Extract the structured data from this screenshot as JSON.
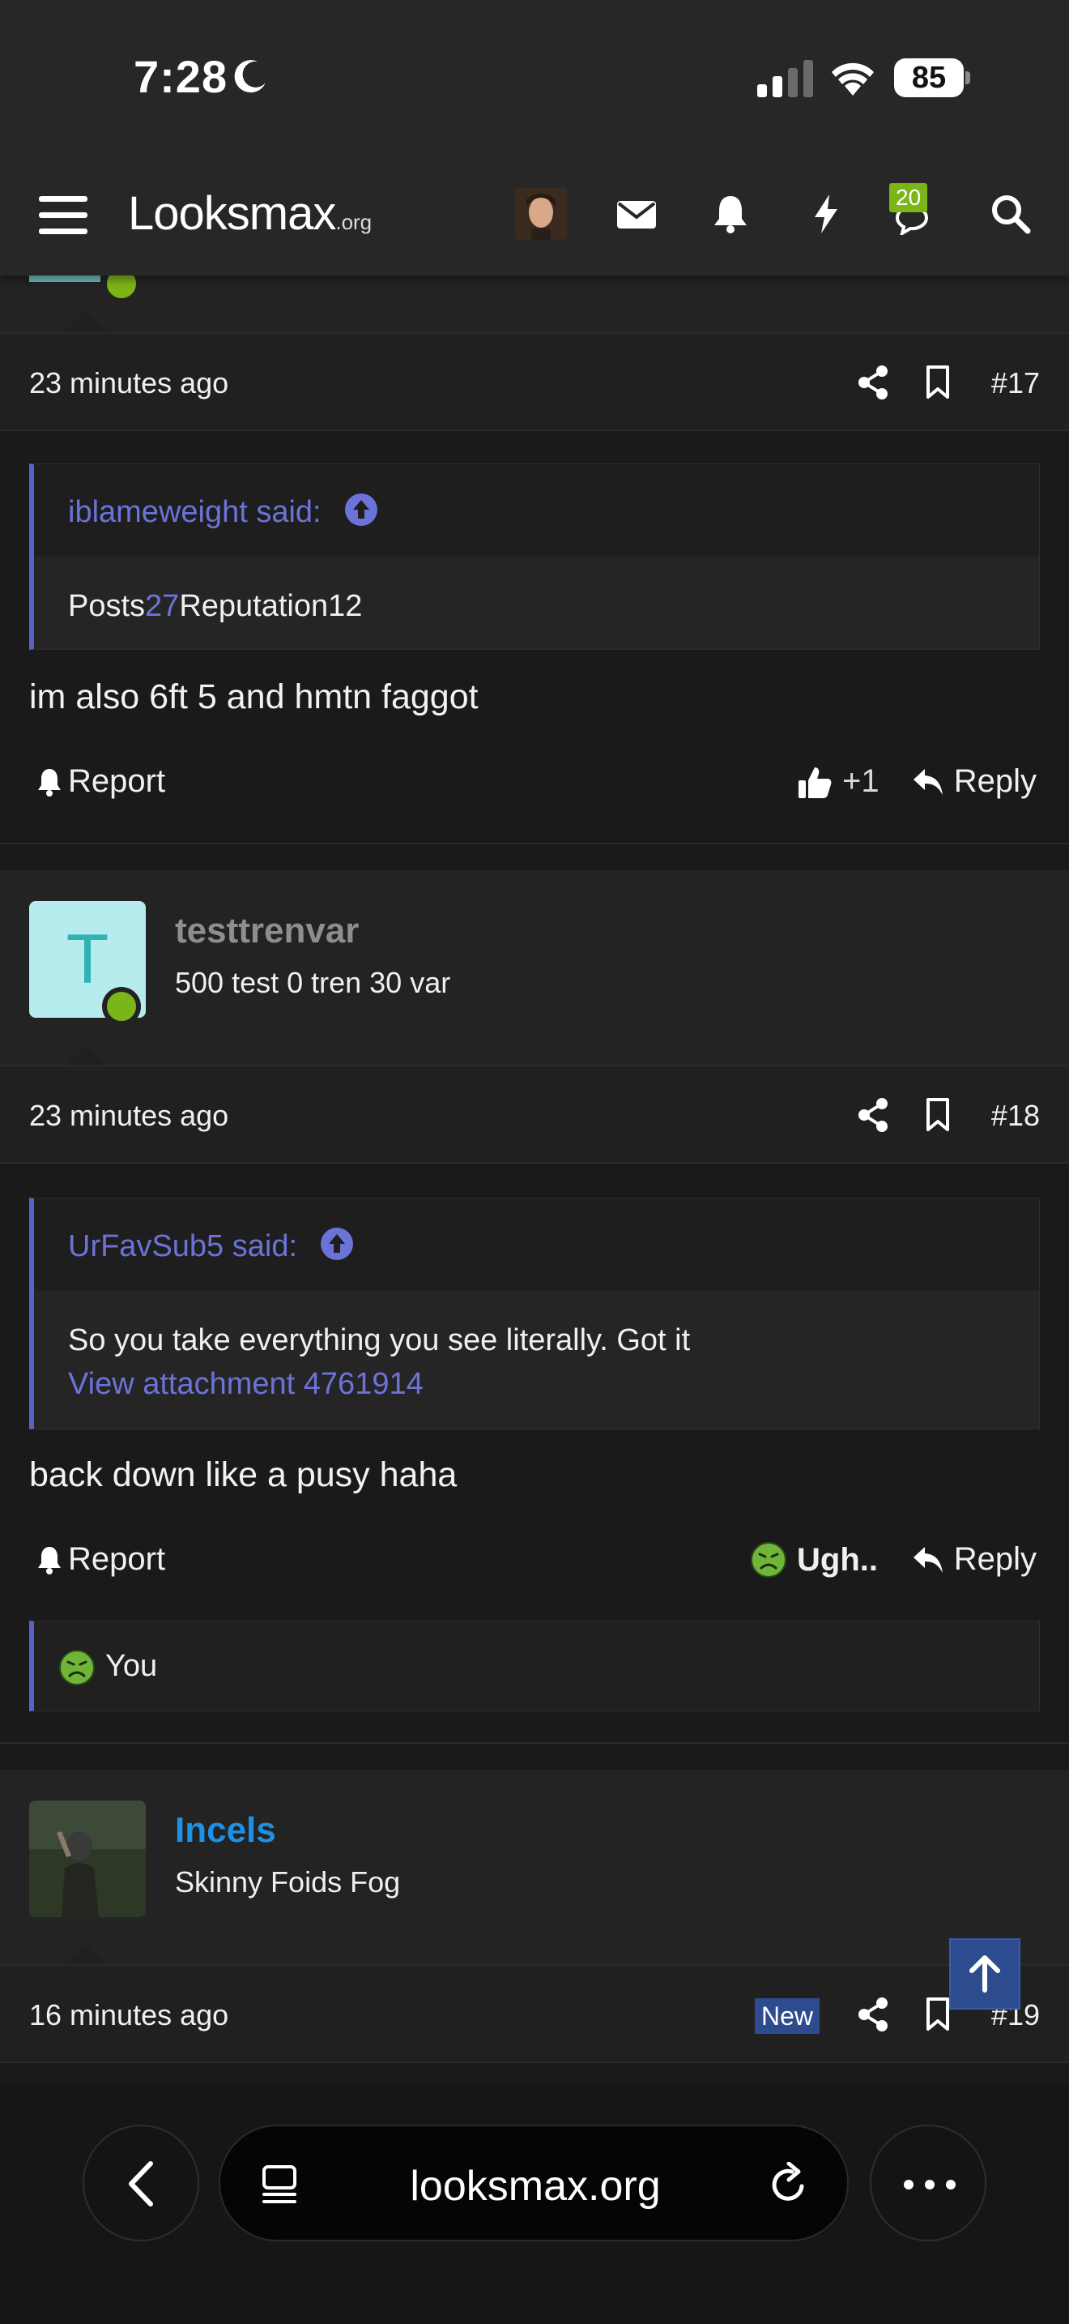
{
  "status_bar": {
    "time": "7:28",
    "battery": "85"
  },
  "header": {
    "logo_main": "Looksmax",
    "logo_tld": ".org",
    "notifications_count": "20"
  },
  "post17": {
    "time": "23 minutes ago",
    "number": "#17",
    "quote_author": "iblameweight said:",
    "quote_posts_label": "Posts",
    "quote_posts_value": "27",
    "quote_rep_label": "Reputation",
    "quote_rep_value": "12",
    "body": "im also 6ft 5 and hmtn faggot",
    "report": "Report",
    "reaction": "+1",
    "reply": "Reply"
  },
  "post18": {
    "username": "testtrenvar",
    "avatar_letter": "T",
    "user_title": "500 test 0 tren 30 var",
    "time": "23 minutes ago",
    "number": "#18",
    "quote_author": "UrFavSub5 said:",
    "quote_text": "So you take everything you see literally. Got it",
    "quote_link": "View attachment 4761914",
    "body": "back down like a pusy haha",
    "report": "Report",
    "reaction": "Ugh..",
    "reply": "Reply",
    "reacted_by": "You"
  },
  "post19": {
    "username": "Incels",
    "user_title": "Skinny Foids Fog",
    "time": "16 minutes ago",
    "new_badge": "New",
    "number": "#19"
  },
  "browser": {
    "url": "looksmax.org"
  },
  "colors": {
    "accent": "#5a62c9",
    "online": "#7cb518",
    "username_link": "#1e90e6",
    "new_badge": "#2d4b8f"
  }
}
